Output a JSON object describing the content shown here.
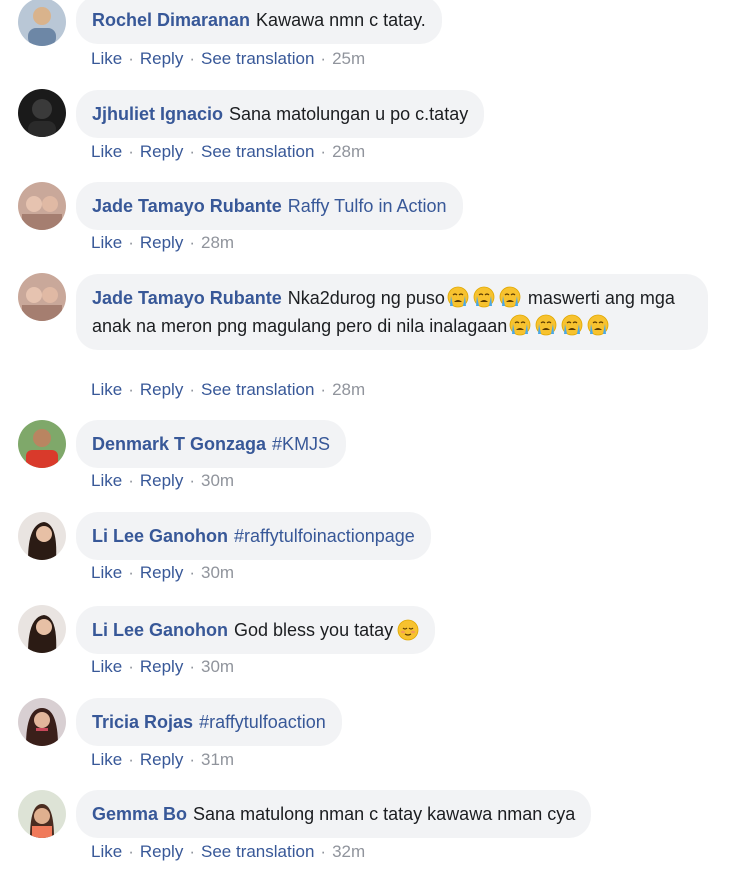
{
  "comments": [
    {
      "author": "Rochel Dimaranan",
      "text": "Kawawa nmn c tatay.",
      "actions": {
        "like": "Like",
        "reply": "Reply",
        "translate": "See translation",
        "time": "25m"
      }
    },
    {
      "author": "Jjhuliet Ignacio",
      "text": "Sana matolungan u po c.tatay",
      "actions": {
        "like": "Like",
        "reply": "Reply",
        "translate": "See translation",
        "time": "28m"
      }
    },
    {
      "author": "Jade Tamayo Rubante",
      "tag": "Raffy Tulfo in Action",
      "actions": {
        "like": "Like",
        "reply": "Reply",
        "time": "28m"
      }
    },
    {
      "author": "Jade Tamayo Rubante",
      "text_part1": "Nka2durog ng puso",
      "text_part2": "maswerti ang mga anak na meron png magulang pero di nila inalagaan",
      "emoji": "crying-face",
      "actions": {
        "like": "Like",
        "reply": "Reply",
        "translate": "See translation",
        "time": "28m"
      }
    },
    {
      "author": "Denmark T Gonzaga",
      "tag": "#KMJS",
      "actions": {
        "like": "Like",
        "reply": "Reply",
        "time": "30m"
      }
    },
    {
      "author": "Li Lee Ganohon",
      "tag": "#raffytulfoinactionpage",
      "actions": {
        "like": "Like",
        "reply": "Reply",
        "time": "30m"
      }
    },
    {
      "author": "Li Lee Ganohon",
      "text": "God bless you tatay",
      "emoji": "blushing-face",
      "actions": {
        "like": "Like",
        "reply": "Reply",
        "time": "30m"
      }
    },
    {
      "author": "Tricia Rojas",
      "tag": "#raffytulfoaction",
      "actions": {
        "like": "Like",
        "reply": "Reply",
        "time": "31m"
      }
    },
    {
      "author": "Gemma Bo",
      "text": "Sana matulong nman c tatay kawawa nman cya",
      "actions": {
        "like": "Like",
        "reply": "Reply",
        "translate": "See translation",
        "time": "32m"
      }
    }
  ],
  "separator": "·",
  "colors": {
    "link": "#385898",
    "bubble": "#f2f3f5",
    "meta": "#90949c",
    "text": "#1c1e21"
  }
}
